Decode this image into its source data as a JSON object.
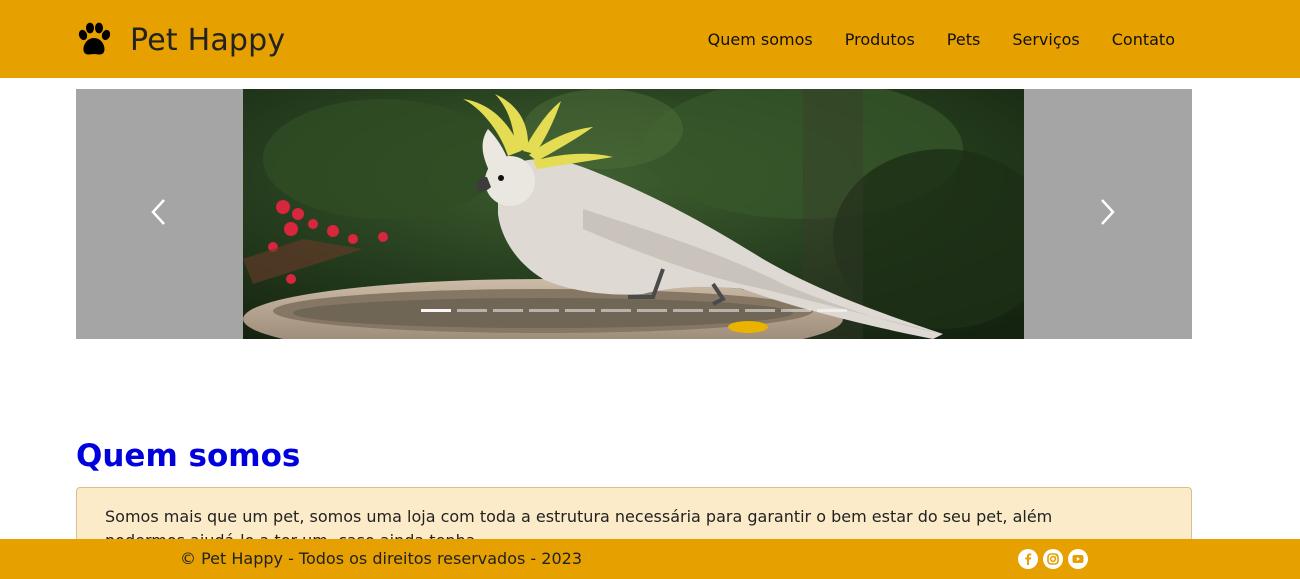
{
  "header": {
    "brand_name": "Pet Happy",
    "nav": [
      "Quem somos",
      "Produtos",
      "Pets",
      "Serviços",
      "Contato"
    ]
  },
  "carousel": {
    "indicator_count": 12,
    "active_index": 0,
    "prev_icon": "chevron-left-icon",
    "next_icon": "chevron-right-icon"
  },
  "about": {
    "title": "Quem somos",
    "text": "Somos mais que um pet, somos uma loja com toda a estrutura necessária para garantir o bem estar do seu pet, além podermos ajudá-lo a ter um, caso ainda tenha."
  },
  "footer": {
    "copyright": "© Pet Happy - Todos os direitos reservados - 2023",
    "social": [
      "facebook-icon",
      "instagram-icon",
      "youtube-icon"
    ]
  },
  "colors": {
    "brand": "#e6a000",
    "title": "#0000dd",
    "card_bg": "#fbebc9"
  }
}
